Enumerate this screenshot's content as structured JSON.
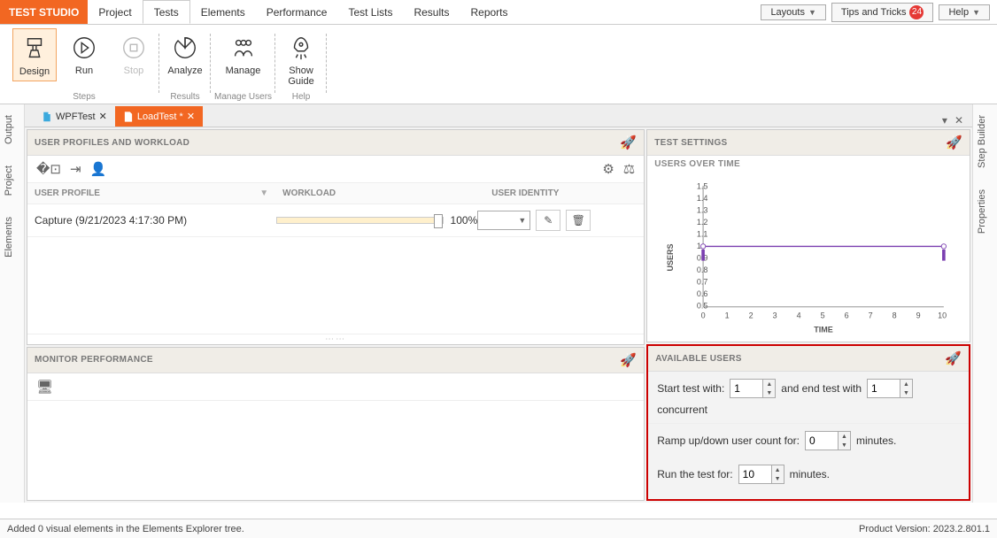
{
  "brand": "TEST STUDIO",
  "menu": {
    "items": [
      "Project",
      "Tests",
      "Elements",
      "Performance",
      "Test Lists",
      "Results",
      "Reports"
    ],
    "active": 1
  },
  "topButtons": {
    "layouts": "Layouts",
    "tips": "Tips and Tricks",
    "tipsBadge": "24",
    "help": "Help"
  },
  "ribbon": {
    "design": "Design",
    "run": "Run",
    "stop": "Stop",
    "analyze": "Analyze",
    "manage": "Manage",
    "guide": "Show\nGuide",
    "groups": {
      "steps": "Steps",
      "results": "Results",
      "users": "Manage Users",
      "help": "Help"
    }
  },
  "sideLeft": [
    "Output",
    "Project",
    "Elements"
  ],
  "sideRight": [
    "Step Builder",
    "Properties"
  ],
  "docTabs": {
    "t0": {
      "label": "WPFTest"
    },
    "t1": {
      "label": "LoadTest *"
    }
  },
  "profilesPanel": {
    "title": "USER PROFILES AND WORKLOAD",
    "cols": {
      "profile": "USER PROFILE",
      "workload": "WORKLOAD",
      "identity": "USER IDENTITY"
    },
    "row0": {
      "name": "Capture (9/21/2023 4:17:30 PM)",
      "pct": "100%"
    }
  },
  "monitorPanel": {
    "title": "MONITOR PERFORMANCE"
  },
  "settingsPanel": {
    "title": "TEST SETTINGS",
    "usersOver": "USERS OVER TIME"
  },
  "chart": {
    "ylabel": "USERS",
    "xlabel": "TIME"
  },
  "chart_data": {
    "type": "line",
    "title": "USERS OVER TIME",
    "xlabel": "TIME",
    "ylabel": "USERS",
    "x": [
      0,
      1,
      2,
      3,
      4,
      5,
      6,
      7,
      8,
      9,
      10
    ],
    "x_ticks": [
      0,
      1,
      2,
      3,
      4,
      5,
      6,
      7,
      8,
      9,
      10
    ],
    "y_ticks": [
      0.5,
      0.6,
      0.7,
      0.8,
      0.9,
      1,
      1.1,
      1.2,
      1.3,
      1.4,
      1.5
    ],
    "ylim": [
      0.5,
      1.5
    ],
    "series": [
      {
        "name": "users",
        "values": [
          1,
          1,
          1,
          1,
          1,
          1,
          1,
          1,
          1,
          1,
          1
        ]
      }
    ]
  },
  "avail": {
    "title": "AVAILABLE USERS",
    "startLabel": "Start test with:",
    "startVal": "1",
    "endLabel": "and end test with",
    "endVal": "1",
    "concurrent": "concurrent",
    "rampLabel": "Ramp up/down user count for:",
    "rampVal": "0",
    "minutes": "minutes.",
    "runLabel": "Run the test for:",
    "runVal": "10"
  },
  "status": {
    "msg": "Added 0 visual elements in the Elements Explorer tree.",
    "ver": "Product Version: 2023.2.801.1"
  }
}
